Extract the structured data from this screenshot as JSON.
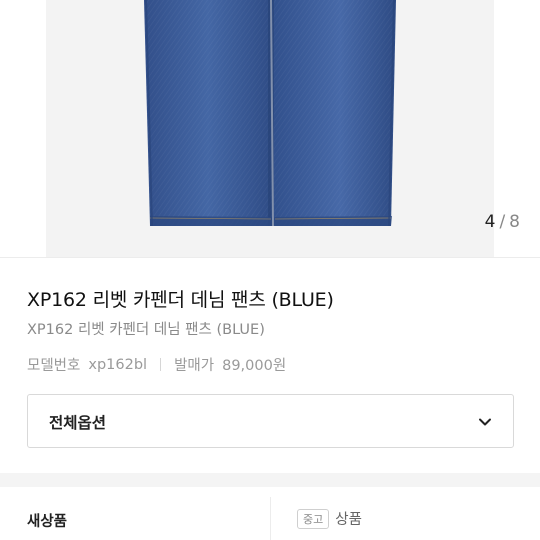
{
  "gallery": {
    "current": "4",
    "separator": "/",
    "total": "8"
  },
  "product": {
    "title": "XP162 리벳 카펜더 데님 팬츠 (BLUE)",
    "subtitle": "XP162 리벳 카펜더 데님 팬츠 (BLUE)",
    "model_label": "모델번호",
    "model_value": "xp162bl",
    "price_label": "발매가",
    "price_value": "89,000원"
  },
  "options": {
    "label": "전체옵션"
  },
  "condition": {
    "new_label": "새상품",
    "used_badge": "중고",
    "used_label": "상품"
  },
  "colors": {
    "denim": "#3b5a95",
    "text_primary": "#222222",
    "text_muted": "#9a9a9a"
  }
}
